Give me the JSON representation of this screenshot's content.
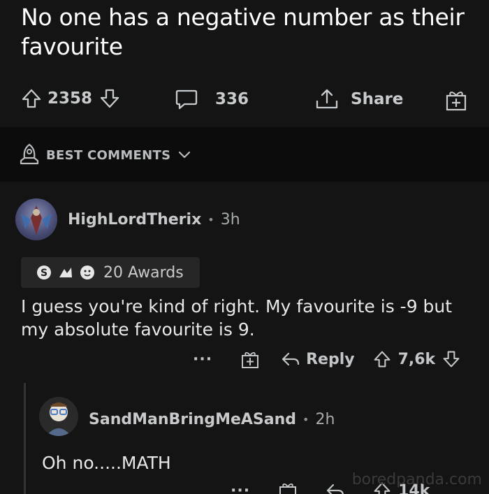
{
  "post": {
    "title": "No one has a negative number as their favourite",
    "upvotes": "2358",
    "comments": "336",
    "share_label": "Share"
  },
  "sort": {
    "label": "BEST COMMENTS"
  },
  "comments": [
    {
      "author": "HighLordTherix",
      "separator": "•",
      "time": "3h",
      "awards": "20 Awards",
      "body": "I guess you're kind of right. My favourite is -9 but my absolute favourite is 9.",
      "more": "···",
      "reply_label": "Reply",
      "votes": "7,6k"
    },
    {
      "author": "SandManBringMeASand",
      "separator": "•",
      "time": "2h",
      "body": "Oh no.....MATH",
      "more": "···",
      "votes": "14k"
    }
  ],
  "watermark": "boredpanda.com",
  "icons": {
    "upvote": "upvote-arrow-icon",
    "downvote": "downvote-arrow-icon",
    "comment": "comment-bubble-icon",
    "share": "share-icon",
    "award": "gift-award-icon",
    "sort": "rocket-icon",
    "reply": "reply-arrow-icon"
  }
}
